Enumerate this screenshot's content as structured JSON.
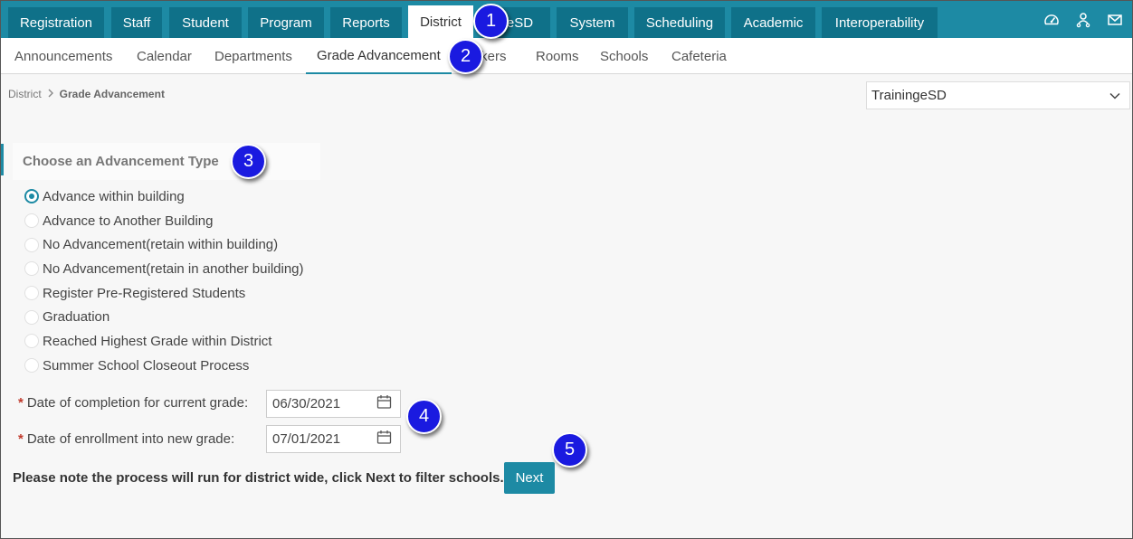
{
  "top_tabs": [
    {
      "label": "Registration",
      "active": false
    },
    {
      "label": "Staff",
      "active": false
    },
    {
      "label": "Student",
      "active": false
    },
    {
      "label": "Program",
      "active": false
    },
    {
      "label": "Reports",
      "active": false
    },
    {
      "label": "District",
      "active": true
    },
    {
      "label": "eSD",
      "active": false
    },
    {
      "label": "System",
      "active": false
    },
    {
      "label": "Scheduling",
      "active": false
    },
    {
      "label": "Academic",
      "active": false
    },
    {
      "label": "Interoperability",
      "active": false
    }
  ],
  "top_icons": [
    "dashboard-icon",
    "user-network-icon",
    "mail-icon"
  ],
  "sub_tabs": [
    {
      "label": "Announcements",
      "active": false
    },
    {
      "label": "Calendar",
      "active": false
    },
    {
      "label": "Departments",
      "active": false
    },
    {
      "label": "Grade Advancement",
      "active": true
    },
    {
      "label": "Lockers",
      "active": false
    },
    {
      "label": "Rooms",
      "active": false
    },
    {
      "label": "Schools",
      "active": false
    },
    {
      "label": "Cafeteria",
      "active": false
    }
  ],
  "breadcrumb": {
    "root": "District",
    "current": "Grade Advancement"
  },
  "district_select": {
    "value": "TrainingeSD"
  },
  "advancement": {
    "header": "Choose an Advancement Type",
    "options": [
      {
        "label": "Advance within building",
        "checked": true
      },
      {
        "label": "Advance to Another Building",
        "checked": false
      },
      {
        "label": "No Advancement(retain within building)",
        "checked": false
      },
      {
        "label": "No Advancement(retain in another building)",
        "checked": false
      },
      {
        "label": "Register Pre-Registered Students",
        "checked": false
      },
      {
        "label": "Graduation",
        "checked": false
      },
      {
        "label": "Reached Highest Grade within District",
        "checked": false
      },
      {
        "label": "Summer School Closeout Process",
        "checked": false
      }
    ]
  },
  "dates": {
    "required_mark": "*",
    "completion_label": "Date of completion for current grade:",
    "completion_value": "06/30/2021",
    "enrollment_label": "Date of enrollment into new grade:",
    "enrollment_value": "07/01/2021"
  },
  "note": "Please note the process will run for district wide, click Next to filter schools.",
  "next_label": "Next",
  "callouts": [
    "1",
    "2",
    "3",
    "4",
    "5"
  ],
  "colors": {
    "accent": "#1d8aa4",
    "tab_dark": "#0f7189",
    "callout": "#1a1ae0",
    "required": "#c0392b"
  }
}
